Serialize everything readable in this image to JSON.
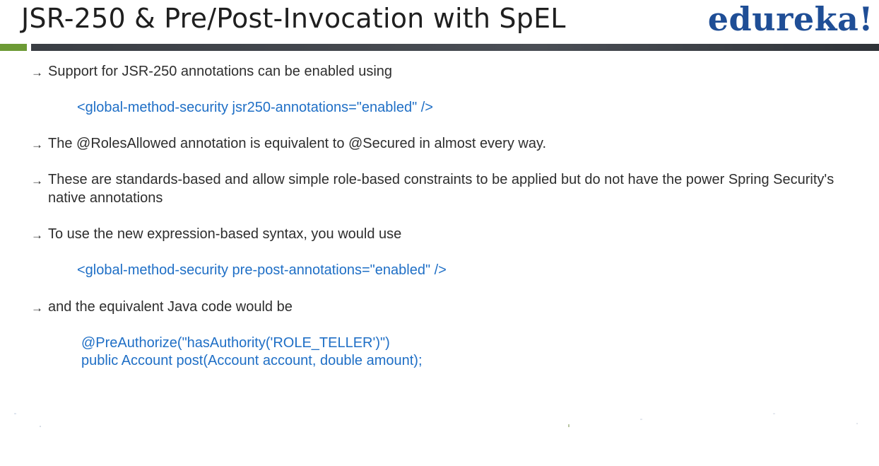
{
  "slide": {
    "title": "JSR-250 & Pre/Post-Invocation with SpEL",
    "logo": "edureka!",
    "colors": {
      "title": "#1f1f1f",
      "logo": "#1f4e96",
      "accent_green": "#6c9a35",
      "rule_dark": "#3a3e44",
      "code": "#1f6fc6",
      "body_text": "#2e2e2e"
    },
    "arrow_glyph": "→",
    "bullets": [
      {
        "text": "Support for JSR-250 annotations can be enabled using"
      },
      {
        "text": "The @RolesAllowed annotation is equivalent to @Secured in almost every way."
      },
      {
        "text": "These are standards-based and allow simple role-based constraints to be applied but do not have the power Spring Security's native annotations"
      },
      {
        "text": "To use the new expression-based syntax, you would use"
      },
      {
        "text": "and the equivalent Java code would be"
      }
    ],
    "code_lines": [
      "<global-method-security jsr250-annotations=\"enabled\" />",
      "<global-method-security pre-post-annotations=\"enabled\" />",
      "@PreAuthorize(\"hasAuthority('ROLE_TELLER')\")",
      "public Account post(Account account, double amount);"
    ]
  }
}
